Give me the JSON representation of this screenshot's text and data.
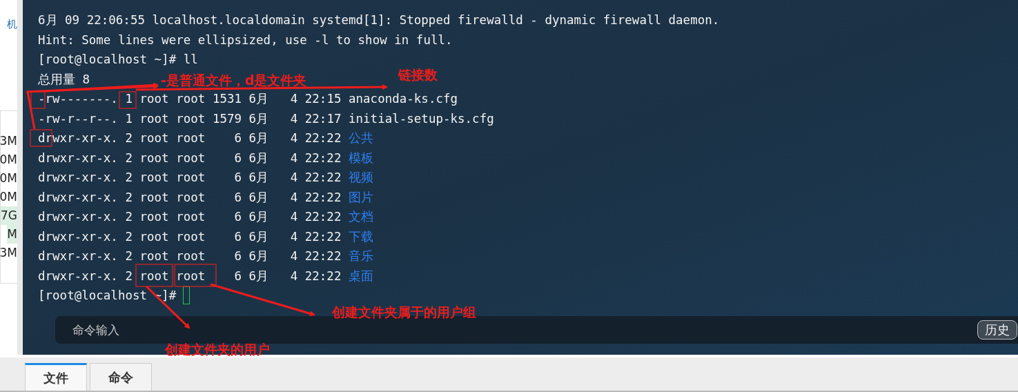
{
  "sidebar": {
    "label": "机",
    "sizes": [
      {
        "text": "3M",
        "highlighted": false
      },
      {
        "text": "0M",
        "highlighted": false
      },
      {
        "text": "0M",
        "highlighted": false
      },
      {
        "text": "0M",
        "highlighted": false
      },
      {
        "text": "7G",
        "highlighted": true
      },
      {
        "text": "M",
        "highlighted": true
      },
      {
        "text": "3M",
        "highlighted": false
      }
    ]
  },
  "terminal": {
    "lines": [
      {
        "kind": "text",
        "text": "6月 09 22:06:55 localhost.localdomain systemd[1]: Stopped firewalld - dynamic firewall daemon."
      },
      {
        "kind": "text",
        "text": "Hint: Some lines were ellipsized, use -l to show in full."
      },
      {
        "kind": "text",
        "text": "[root@localhost ~]# ll"
      },
      {
        "kind": "text",
        "text": "总用量 8"
      },
      {
        "kind": "file",
        "type": "-",
        "mode": "rw-------.",
        "links": "1",
        "owner": "root",
        "group": "root",
        "size": "1531",
        "month": "6月",
        "day": "4",
        "time": "22:15",
        "name": "anaconda-ks.cfg"
      },
      {
        "kind": "file",
        "type": "-",
        "mode": "rw-r--r--.",
        "links": "1",
        "owner": "root",
        "group": "root",
        "size": "1579",
        "month": "6月",
        "day": "4",
        "time": "22:17",
        "name": "initial-setup-ks.cfg"
      },
      {
        "kind": "dir",
        "type": "d",
        "mode": "rwxr-xr-x.",
        "links": "2",
        "owner": "root",
        "group": "root",
        "size": "6",
        "month": "6月",
        "day": "4",
        "time": "22:22",
        "name": "公共"
      },
      {
        "kind": "dir",
        "type": "d",
        "mode": "rwxr-xr-x.",
        "links": "2",
        "owner": "root",
        "group": "root",
        "size": "6",
        "month": "6月",
        "day": "4",
        "time": "22:22",
        "name": "模板"
      },
      {
        "kind": "dir",
        "type": "d",
        "mode": "rwxr-xr-x.",
        "links": "2",
        "owner": "root",
        "group": "root",
        "size": "6",
        "month": "6月",
        "day": "4",
        "time": "22:22",
        "name": "视频"
      },
      {
        "kind": "dir",
        "type": "d",
        "mode": "rwxr-xr-x.",
        "links": "2",
        "owner": "root",
        "group": "root",
        "size": "6",
        "month": "6月",
        "day": "4",
        "time": "22:22",
        "name": "图片"
      },
      {
        "kind": "dir",
        "type": "d",
        "mode": "rwxr-xr-x.",
        "links": "2",
        "owner": "root",
        "group": "root",
        "size": "6",
        "month": "6月",
        "day": "4",
        "time": "22:22",
        "name": "文档"
      },
      {
        "kind": "dir",
        "type": "d",
        "mode": "rwxr-xr-x.",
        "links": "2",
        "owner": "root",
        "group": "root",
        "size": "6",
        "month": "6月",
        "day": "4",
        "time": "22:22",
        "name": "下载"
      },
      {
        "kind": "dir",
        "type": "d",
        "mode": "rwxr-xr-x.",
        "links": "2",
        "owner": "root",
        "group": "root",
        "size": "6",
        "month": "6月",
        "day": "4",
        "time": "22:22",
        "name": "音乐"
      },
      {
        "kind": "dir",
        "type": "d",
        "mode": "rwxr-xr-x.",
        "links": "2",
        "owner": "root",
        "group": "root",
        "size": "6",
        "month": "6月",
        "day": "4",
        "time": "22:22",
        "name": "桌面"
      },
      {
        "kind": "prompt",
        "text": "[root@localhost ~]#"
      }
    ]
  },
  "annotations": [
    "-是普通文件，d是文件夹",
    "链接数",
    "创建文件夹属于的用户组",
    "创建文件夹的用户"
  ],
  "command_bar": {
    "placeholder": "命令输入",
    "button": "历史"
  },
  "tabs": [
    {
      "label": "文件",
      "selected": true
    },
    {
      "label": "命令",
      "selected": false
    }
  ]
}
